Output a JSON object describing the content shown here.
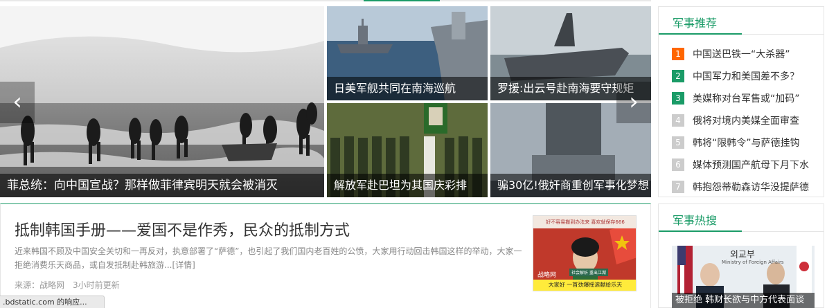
{
  "slider": {
    "main_caption": "菲总统：向中国宣战？那样做菲律宾明天就会被消灭",
    "tiles": [
      {
        "caption": "日美军舰共同在南海巡航"
      },
      {
        "caption": "罗援:出云号赴南海要守规矩"
      },
      {
        "caption": "解放军赴巴坦为其国庆彩排"
      },
      {
        "caption": "骗30亿!俄奸商重创军事化梦想"
      }
    ],
    "prev_icon": "‹",
    "next_icon": "›"
  },
  "article": {
    "title": "抵制韩国手册——爱国不是作秀，民众的抵制方式",
    "summary": "近来韩国不顾及中国安全关切和一再反对，执意部署了“萨德”，也引起了我们国内老百姓的公愤，大家用行动回击韩国这样的举动，大家一拒绝消费乐天商品，或自发抵制赴韩旅游...",
    "more": "[详情]",
    "source": "来源：战略网",
    "time": "3小时前更新",
    "thumb_header": "好不容易搬到办法来 喜欢就保存666",
    "thumb_logo": "战略网",
    "thumb_tag": "社会解析 重出江湖",
    "thumb_footer": "大家好 一首劲爆摇滚献给乐天"
  },
  "recommend": {
    "title": "军事推荐",
    "items": [
      {
        "rank": "1",
        "text": "中国送巴铁一“大杀器”",
        "color": "#ff6600"
      },
      {
        "rank": "2",
        "text": "中国军力和美国差不多？",
        "color": "#1a9b67"
      },
      {
        "rank": "3",
        "text": "美媒称对台军售或“加码”",
        "color": "#1a9b67"
      },
      {
        "rank": "4",
        "text": "俄将对境内美媒全面审查",
        "color": "#cccccc"
      },
      {
        "rank": "5",
        "text": "韩将“限韩令”与萨德挂钩",
        "color": "#cccccc"
      },
      {
        "rank": "6",
        "text": "媒体预测国产航母下月下水",
        "color": "#cccccc"
      },
      {
        "rank": "7",
        "text": "韩抱怨蒂勒森访华没提萨德",
        "color": "#cccccc"
      }
    ]
  },
  "hot": {
    "title": "军事热搜",
    "image_caption": "被拒绝 韩财长欲与中方代表面谈",
    "image_sign": "외교부",
    "image_sign_en": "Ministry of Foreign Affairs"
  },
  "statusbar": {
    "text": ".bdstatic.com 的响应..."
  },
  "colors": {
    "accent": "#1a9b67",
    "rank_top": "#ff6600",
    "rank_mid": "#1a9b67",
    "rank_rest": "#cccccc"
  }
}
